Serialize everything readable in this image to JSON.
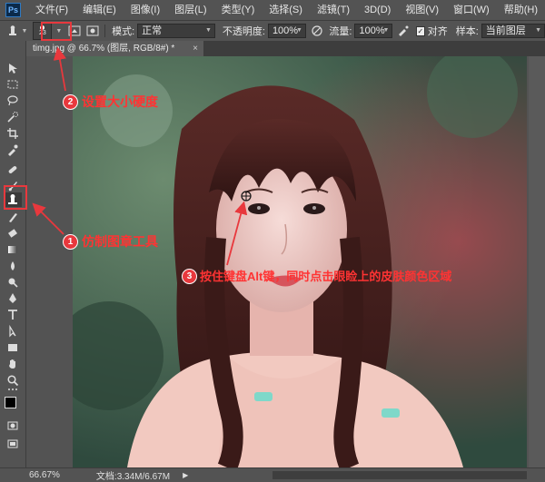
{
  "menubar": {
    "logo": "Ps",
    "items": [
      "文件(F)",
      "编辑(E)",
      "图像(I)",
      "图层(L)",
      "类型(Y)",
      "选择(S)",
      "滤镜(T)",
      "3D(D)",
      "视图(V)",
      "窗口(W)",
      "帮助(H)"
    ]
  },
  "options": {
    "brush_size": "23",
    "mode_label": "模式:",
    "mode_value": "正常",
    "opacity_label": "不透明度:",
    "opacity_value": "100%",
    "flow_label": "流量:",
    "flow_value": "100%",
    "align_label": "对齐",
    "sample_label": "样本:",
    "sample_value": "当前图层"
  },
  "document": {
    "tab_title": "timg.jpg @ 66.7% (图层, RGB/8#) *",
    "close_glyph": "×"
  },
  "status": {
    "zoom": "66.67%",
    "doc_info": "文档:3.34M/6.67M"
  },
  "annotations": {
    "a1_num": "1",
    "a1_text": "仿制图章工具",
    "a2_num": "2",
    "a2_text": "设置大小硬度",
    "a3_num": "3",
    "a3_text": "按住键盘Alt键，同时点击眼睑上的皮肤颜色区域"
  },
  "colors": {
    "accent_red": "#e8383d",
    "ui_gray": "#535353"
  }
}
